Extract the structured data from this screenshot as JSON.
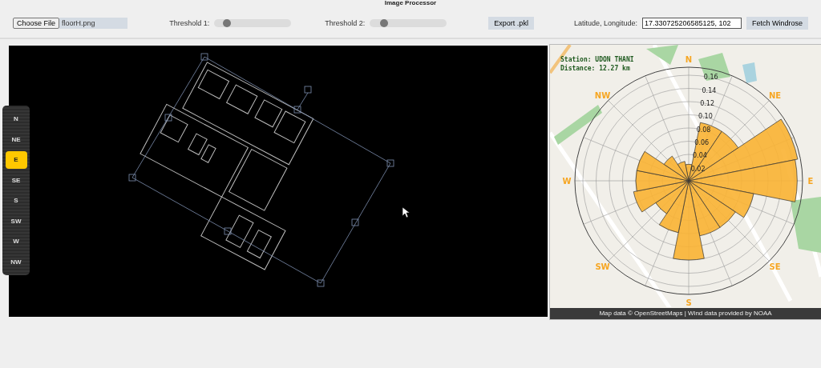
{
  "window": {
    "title": "Image Processor"
  },
  "toolbar": {
    "file_button": "Choose File",
    "file_name": "floorH.png",
    "thresholds": [
      {
        "label": "Threshold 1:",
        "level": 0.12
      },
      {
        "label": "Threshold 2:",
        "level": 0.15
      }
    ],
    "export_button": "Export .pkl",
    "coords_label": "Latitude, Longitude:",
    "coords_value": "17.330725206585125, 102",
    "fetch_button": "Fetch Windrose"
  },
  "directions": [
    {
      "label": "N",
      "selected": false
    },
    {
      "label": "NE",
      "selected": false
    },
    {
      "label": "E",
      "selected": true
    },
    {
      "label": "SE",
      "selected": false
    },
    {
      "label": "S",
      "selected": false
    },
    {
      "label": "SW",
      "selected": false
    },
    {
      "label": "W",
      "selected": false
    },
    {
      "label": "NW",
      "selected": false
    }
  ],
  "windrose": {
    "station": "Station: UDON THANI",
    "distance": "Distance: 12.27 km",
    "compass_labels": [
      "N",
      "NE",
      "E",
      "SE",
      "S",
      "SW",
      "W",
      "NW"
    ],
    "ring_labels": [
      "0.16",
      "0.14",
      "0.12",
      "0.10",
      "0.08",
      "0.06",
      "0.04",
      "0.02"
    ],
    "attribution": "Map data © OpenStreetMaps | Wind data provided by NOAA"
  }
}
